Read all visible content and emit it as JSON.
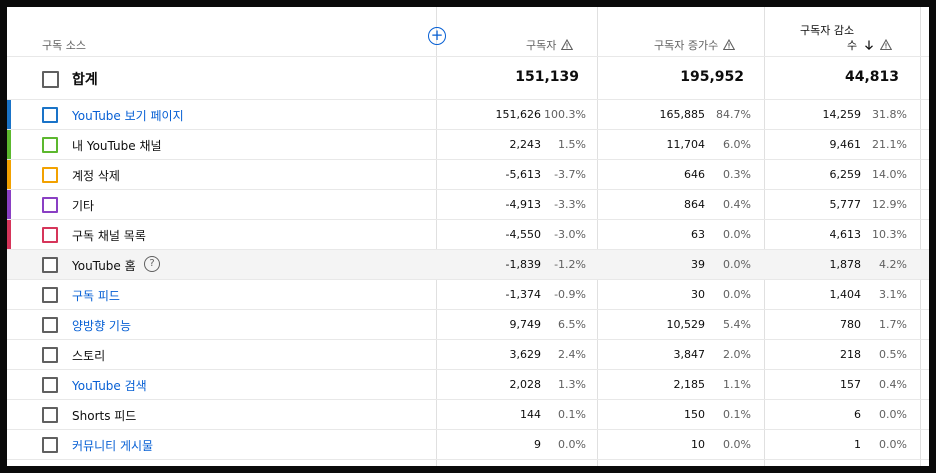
{
  "header": {
    "source_col": "구독 소스",
    "subscribers_col": "구독자",
    "gained_col": "구독자 증가수",
    "lost_col_line1": "구독자 감소",
    "lost_col_line2": "수",
    "add_button": "+"
  },
  "total": {
    "label": "합계",
    "subscribers": "151,139",
    "gained": "195,952",
    "lost": "44,813"
  },
  "colors": {
    "link": "#065fd4",
    "bar_blue": "#1a73c8",
    "bar_green": "#5cb82e",
    "bar_orange": "#f2a100",
    "bar_purple": "#8a3fc4",
    "bar_red": "#d6355a"
  },
  "rows": [
    {
      "label": "YouTube 보기 페이지",
      "link": true,
      "color": "#1a73c8",
      "subs": "151,626",
      "subs_pct": "100.3%",
      "gain": "165,885",
      "gain_pct": "84.7%",
      "lost": "14,259",
      "lost_pct": "31.8%"
    },
    {
      "label": "내 YouTube 채널",
      "link": false,
      "color": "#5cb82e",
      "subs": "2,243",
      "subs_pct": "1.5%",
      "gain": "11,704",
      "gain_pct": "6.0%",
      "lost": "9,461",
      "lost_pct": "21.1%"
    },
    {
      "label": "계정 삭제",
      "link": false,
      "color": "#f2a100",
      "subs": "-5,613",
      "subs_pct": "-3.7%",
      "gain": "646",
      "gain_pct": "0.3%",
      "lost": "6,259",
      "lost_pct": "14.0%"
    },
    {
      "label": "기타",
      "link": false,
      "color": "#8a3fc4",
      "subs": "-4,913",
      "subs_pct": "-3.3%",
      "gain": "864",
      "gain_pct": "0.4%",
      "lost": "5,777",
      "lost_pct": "12.9%"
    },
    {
      "label": "구독 채널 목록",
      "link": false,
      "color": "#d6355a",
      "subs": "-4,550",
      "subs_pct": "-3.0%",
      "gain": "63",
      "gain_pct": "0.0%",
      "lost": "4,613",
      "lost_pct": "10.3%"
    },
    {
      "label": "YouTube 홈",
      "link": false,
      "help": true,
      "color": "",
      "subs": "-1,839",
      "subs_pct": "-1.2%",
      "gain": "39",
      "gain_pct": "0.0%",
      "lost": "1,878",
      "lost_pct": "4.2%"
    },
    {
      "label": "구독 피드",
      "link": true,
      "color": "",
      "subs": "-1,374",
      "subs_pct": "-0.9%",
      "gain": "30",
      "gain_pct": "0.0%",
      "lost": "1,404",
      "lost_pct": "3.1%"
    },
    {
      "label": "양방향 기능",
      "link": true,
      "color": "",
      "subs": "9,749",
      "subs_pct": "6.5%",
      "gain": "10,529",
      "gain_pct": "5.4%",
      "lost": "780",
      "lost_pct": "1.7%"
    },
    {
      "label": "스토리",
      "link": false,
      "color": "",
      "subs": "3,629",
      "subs_pct": "2.4%",
      "gain": "3,847",
      "gain_pct": "2.0%",
      "lost": "218",
      "lost_pct": "0.5%"
    },
    {
      "label": "YouTube 검색",
      "link": true,
      "color": "",
      "subs": "2,028",
      "subs_pct": "1.3%",
      "gain": "2,185",
      "gain_pct": "1.1%",
      "lost": "157",
      "lost_pct": "0.4%"
    },
    {
      "label": "Shorts 피드",
      "link": false,
      "color": "",
      "subs": "144",
      "subs_pct": "0.1%",
      "gain": "150",
      "gain_pct": "0.1%",
      "lost": "6",
      "lost_pct": "0.0%"
    },
    {
      "label": "커뮤니티 게시물",
      "link": true,
      "color": "",
      "subs": "9",
      "subs_pct": "0.0%",
      "gain": "10",
      "gain_pct": "0.0%",
      "lost": "1",
      "lost_pct": "0.0%"
    }
  ]
}
